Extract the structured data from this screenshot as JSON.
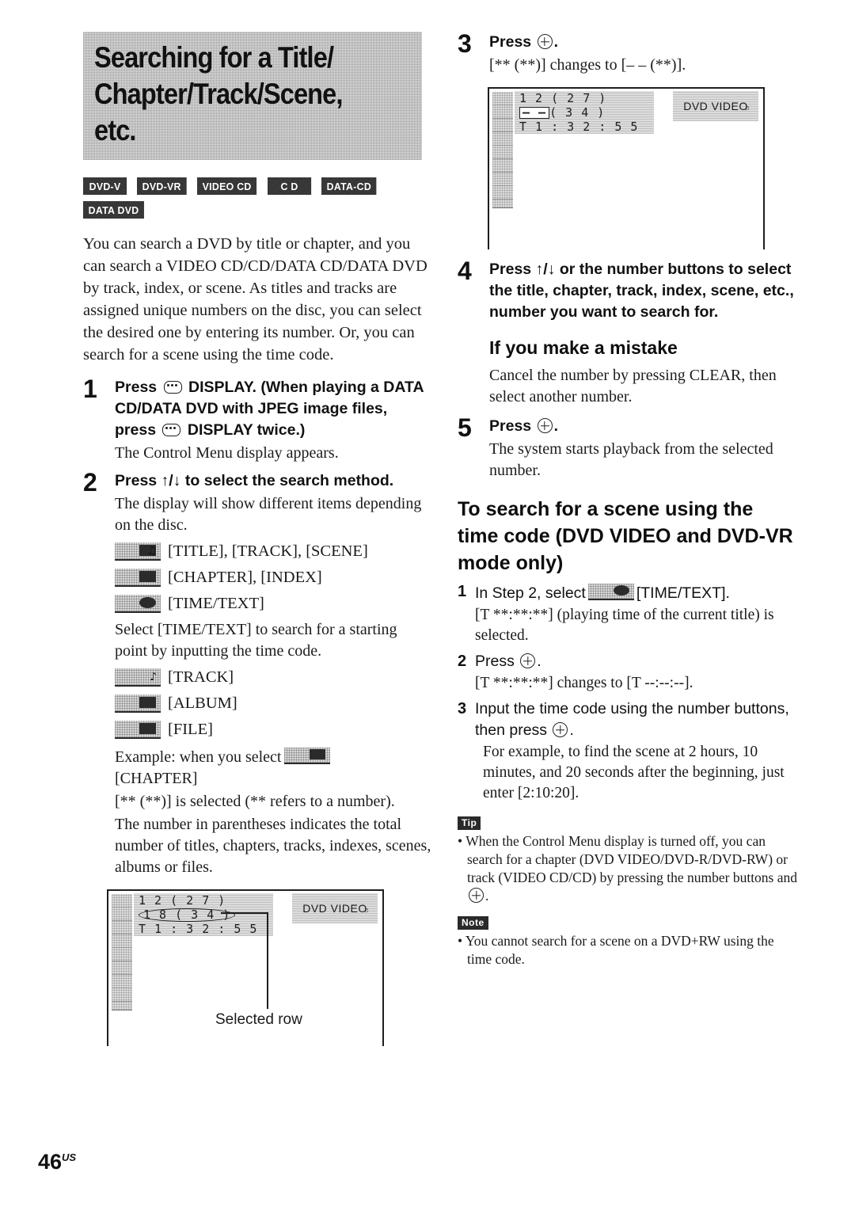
{
  "page": {
    "folio_number": "46",
    "folio_region": "US"
  },
  "title": {
    "lines": [
      "Searching for a Title/",
      "Chapter/Track/Scene,",
      "etc."
    ]
  },
  "disc_badges": {
    "row1": [
      "DVD-V",
      "DVD-VR",
      "VIDEO CD",
      "C D",
      "DATA-CD"
    ],
    "row2": [
      "DATA DVD"
    ]
  },
  "intro": "You can search a DVD by title or chapter, and you can search a VIDEO CD/CD/DATA CD/DATA DVD by track, index, or scene. As titles and tracks are assigned unique numbers on the disc, you can select the desired one by entering its number. Or, you can search for a scene using the time code.",
  "steps": {
    "s1": {
      "num": "1",
      "title_a": "Press",
      "title_b": "DISPLAY. (When playing a DATA CD/DATA DVD with JPEG image files, press",
      "title_c": "DISPLAY twice.)",
      "desc": "The Control Menu display appears."
    },
    "s2": {
      "num": "2",
      "title": "Press ↑/↓ to select the search method.",
      "desc": "The display will show different items depending on the disc.",
      "icon_rows": [
        {
          "icon": "title-track-scene-icon",
          "label": "[TITLE], [TRACK], [SCENE]"
        },
        {
          "icon": "chapter-index-icon",
          "label": "[CHAPTER], [INDEX]"
        },
        {
          "icon": "time-text-icon",
          "label": "[TIME/TEXT]"
        }
      ],
      "note_after_icons": "Select [TIME/TEXT] to search for a starting point by inputting the time code.",
      "icon_rows2": [
        {
          "icon": "track-icon",
          "label": "[TRACK]"
        },
        {
          "icon": "album-icon",
          "label": "[ALBUM]"
        },
        {
          "icon": "file-icon",
          "label": "[FILE]"
        }
      ],
      "example_a": "Example: when you select",
      "example_b": "[CHAPTER]",
      "example_c": "[** (**)] is selected (** refers to a number).",
      "example_d": "The number in parentheses indicates the total number of titles, chapters, tracks, indexes, scenes, albums or files."
    },
    "s3": {
      "num": "3",
      "title": "Press",
      "title_tail": ".",
      "desc": "[** (**)] changes to [– – (**)]."
    },
    "s4": {
      "num": "4",
      "title": "Press ↑/↓ or the number buttons to select the title, chapter, track, index, scene, etc., number you want to search for."
    },
    "s5": {
      "num": "5",
      "title": "Press",
      "title_tail": ".",
      "desc": "The system starts playback from the selected number."
    }
  },
  "mistake": {
    "heading": "If you make a mistake",
    "body": "Cancel the number by pressing CLEAR, then select another number."
  },
  "timecode_section": {
    "heading": "To search for a scene using the time code (DVD VIDEO and DVD-VR mode only)",
    "sub1": {
      "num": "1",
      "text_a": "In Step 2, select",
      "text_b": "[TIME/TEXT].",
      "desc": "[T **:**:**] (playing time of the current title) is selected."
    },
    "sub2": {
      "num": "2",
      "text_a": "Press",
      "text_b": ".",
      "desc": "[T **:**:**] changes to [T --:--:--]."
    },
    "sub3": {
      "num": "3",
      "text_a": "Input the time code using the number buttons, then press",
      "text_b": ".",
      "desc": "For example, to find the scene at 2 hours, 10 minutes, and 20 seconds after the beginning, just enter [2:10:20]."
    }
  },
  "tip": {
    "tag": "Tip",
    "body": "When the Control Menu display is turned off, you can search for a chapter (DVD VIDEO/DVD-R/DVD-RW) or track (VIDEO CD/CD) by pressing the number buttons and",
    "body_tail": "."
  },
  "note": {
    "tag": "Note",
    "body": "You cannot search for a scene on a DVD+RW using the time code."
  },
  "tv_screen_1": {
    "row1": "1 2 ( 2 7 )",
    "row2_highlight": "1 8 ( 3 4 )",
    "row3": "T   1 : 3 2 : 5 5",
    "disc_label": "DVD VIDEO",
    "callout": "Selected row"
  },
  "tv_screen_2": {
    "row1": "1 2 ( 2 7 )",
    "row2_highlight": "– –",
    "row2_rest": "( 3 4 )",
    "row3": "T   1 : 3 2 : 5 5",
    "disc_label": "DVD VIDEO"
  }
}
